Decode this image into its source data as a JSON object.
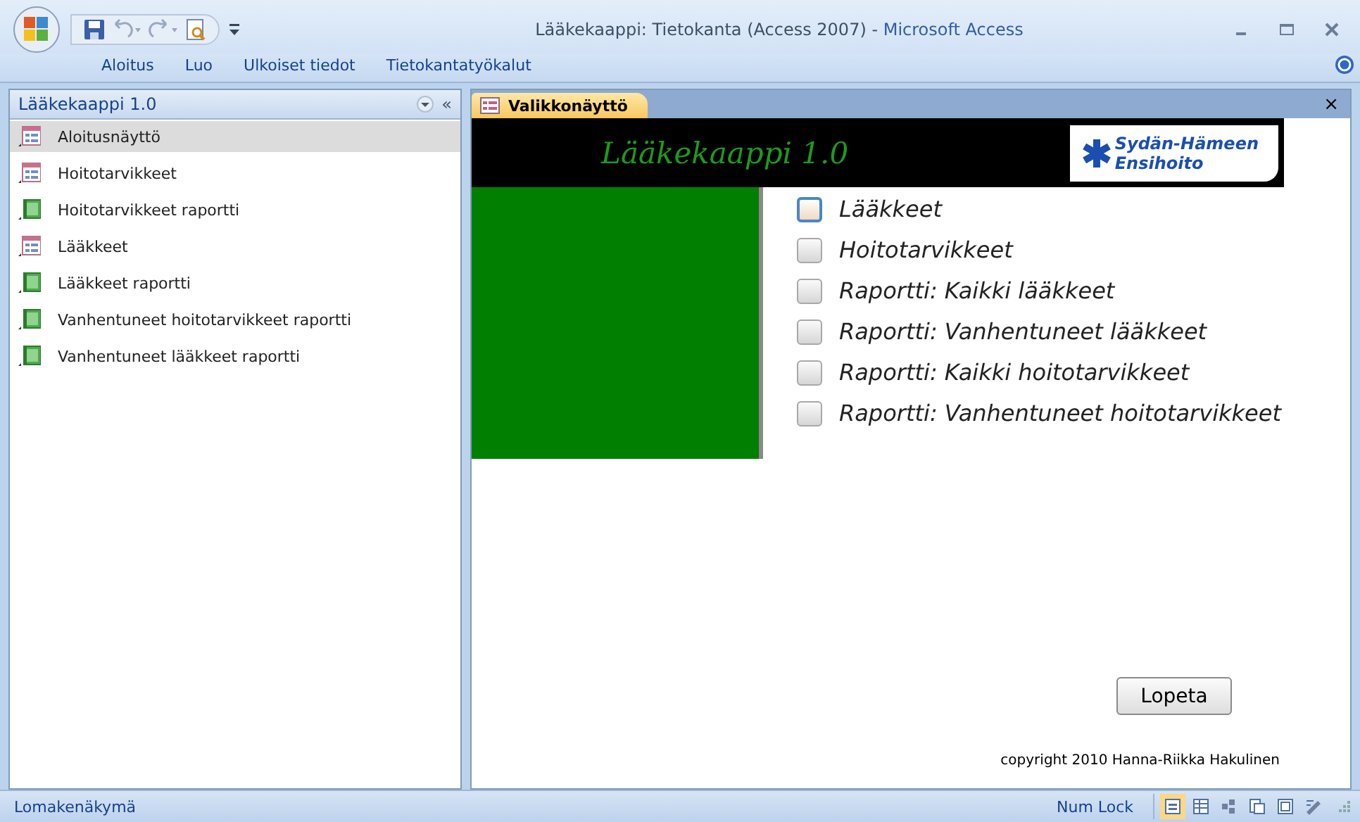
{
  "window": {
    "title": "Lääkekaappi: Tietokanta (Access 2007)",
    "separator": " - ",
    "app_name": "Microsoft Access"
  },
  "ribbon_tabs": [
    {
      "label": "Aloitus",
      "selected": false
    },
    {
      "label": "Luo",
      "selected": false
    },
    {
      "label": "Ulkoiset tiedot",
      "selected": false
    },
    {
      "label": "Tietokantatyökalut",
      "selected": false
    }
  ],
  "nav_pane": {
    "title": "Lääkekaappi 1.0",
    "collapse": "«",
    "items": [
      {
        "label": "Aloitusnäyttö",
        "kind": "form",
        "selected": true
      },
      {
        "label": "Hoitotarvikkeet",
        "kind": "form",
        "selected": false
      },
      {
        "label": "Hoitotarvikkeet raportti",
        "kind": "report",
        "selected": false
      },
      {
        "label": "Lääkkeet",
        "kind": "form",
        "selected": false
      },
      {
        "label": "Lääkkeet raportti",
        "kind": "report",
        "selected": false
      },
      {
        "label": "Vanhentuneet hoitotarvikkeet raportti",
        "kind": "report",
        "selected": false
      },
      {
        "label": "Vanhentuneet lääkkeet raportti",
        "kind": "report",
        "selected": false
      }
    ]
  },
  "document_tab": {
    "label": "Valikkonäyttö",
    "close": "×"
  },
  "form": {
    "banner_title": "Lääkekaappi 1.0",
    "logo_lines": [
      "Sydän-Hämeen",
      "Ensihoito"
    ],
    "options": [
      {
        "label": "Lääkkeet",
        "focused": true
      },
      {
        "label": "Hoitotarvikkeet",
        "focused": false
      },
      {
        "label": "Raportti: Kaikki lääkkeet",
        "focused": false
      },
      {
        "label": "Raportti: Vanhentuneet lääkkeet",
        "focused": false
      },
      {
        "label": "Raportti: Kaikki hoitotarvikkeet",
        "focused": false
      },
      {
        "label": "Raportti: Vanhentuneet hoitotarvikkeet",
        "focused": false
      }
    ],
    "exit_button": "Lopeta",
    "copyright": "copyright 2010 Hanna-Riikka Hakulinen"
  },
  "status_bar": {
    "text": "Lomakenäkymä",
    "num_lock": "Num Lock",
    "views": [
      {
        "selected": true
      },
      {
        "selected": false
      },
      {
        "selected": false
      },
      {
        "selected": false
      },
      {
        "selected": false
      },
      {
        "selected": false
      }
    ]
  }
}
